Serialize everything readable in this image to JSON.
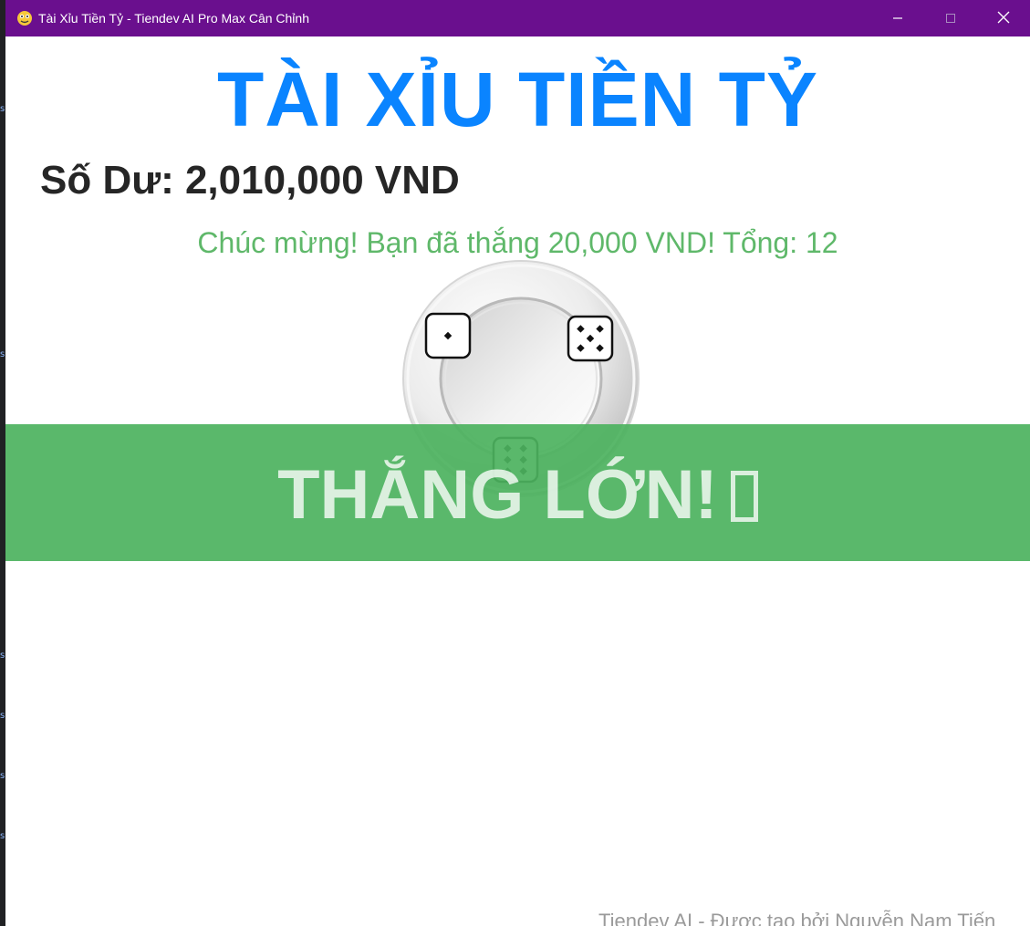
{
  "window": {
    "title": "Tài Xỉu Tiền Tỷ - Tiendev AI Pro Max Cân Chỉnh",
    "controls": [
      "minimize",
      "maximize",
      "close"
    ]
  },
  "game": {
    "title": "TÀI XỈU TIỀN TỶ",
    "balance_label": "Số Dư: 2,010,000 VND",
    "message": "Chúc mừng! Bạn đã thắng 20,000 VND! Tổng: 12",
    "dice": [
      1,
      5,
      6
    ],
    "total": 12,
    "result_banner": "THẮNG LỚN!",
    "footer": "Tiendev AI - Được tạo bởi Nguyễn Nam Tiến"
  },
  "colors": {
    "titlebar": "#6a0f8e",
    "title": "#0a84ff",
    "balance": "#262626",
    "message": "#5fb86a",
    "banner": "#4cb25e",
    "footer": "#9a9a9a"
  },
  "icons": {
    "app": "pygame-snake-icon",
    "minimize": "minimize-icon",
    "maximize": "maximize-icon",
    "close": "close-icon"
  }
}
